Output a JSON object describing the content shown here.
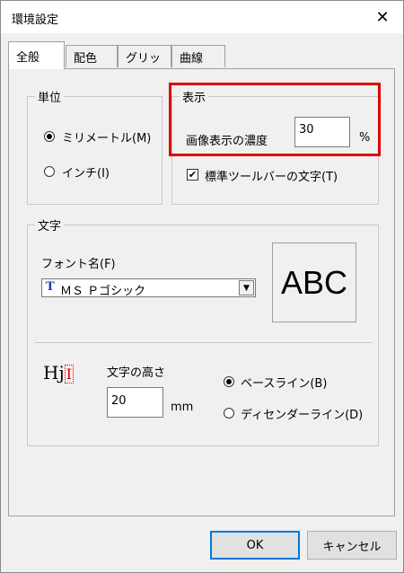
{
  "window": {
    "title": "環境設定",
    "close_glyph": "✕"
  },
  "tabs": [
    {
      "label": "全般"
    },
    {
      "label": "配色"
    },
    {
      "label": "グリッド"
    },
    {
      "label": "曲線"
    }
  ],
  "units_group": {
    "label": "単位",
    "options": [
      {
        "label": "ミリメートル(M)",
        "checked": true
      },
      {
        "label": "インチ(I)",
        "checked": false
      }
    ]
  },
  "display_group": {
    "label": "表示",
    "image_density_label": "画像表示の濃度",
    "image_density_value": "30",
    "percent_unit": "%",
    "toolbar_text_checkbox": {
      "label": "標準ツールバーの文字(T)",
      "checked": true,
      "glyph": "✔"
    }
  },
  "text_group": {
    "label": "文字",
    "font_name_label": "フォント名(F)",
    "font_name_value": "ＭＳ Ｐゴシック",
    "font_type_icon": "truetype-icon",
    "preview_text": "ABC",
    "height_icon_text": "Hj",
    "height_label": "文字の高さ",
    "height_value": "20",
    "height_unit": "mm",
    "baseline_options": [
      {
        "label": "ベースライン(B)",
        "checked": true
      },
      {
        "label": "ディセンダーライン(D)",
        "checked": false
      }
    ]
  },
  "buttons": {
    "ok": "OK",
    "cancel": "キャンセル"
  },
  "colors": {
    "highlight": "#e00000",
    "accent": "#0078d7"
  }
}
